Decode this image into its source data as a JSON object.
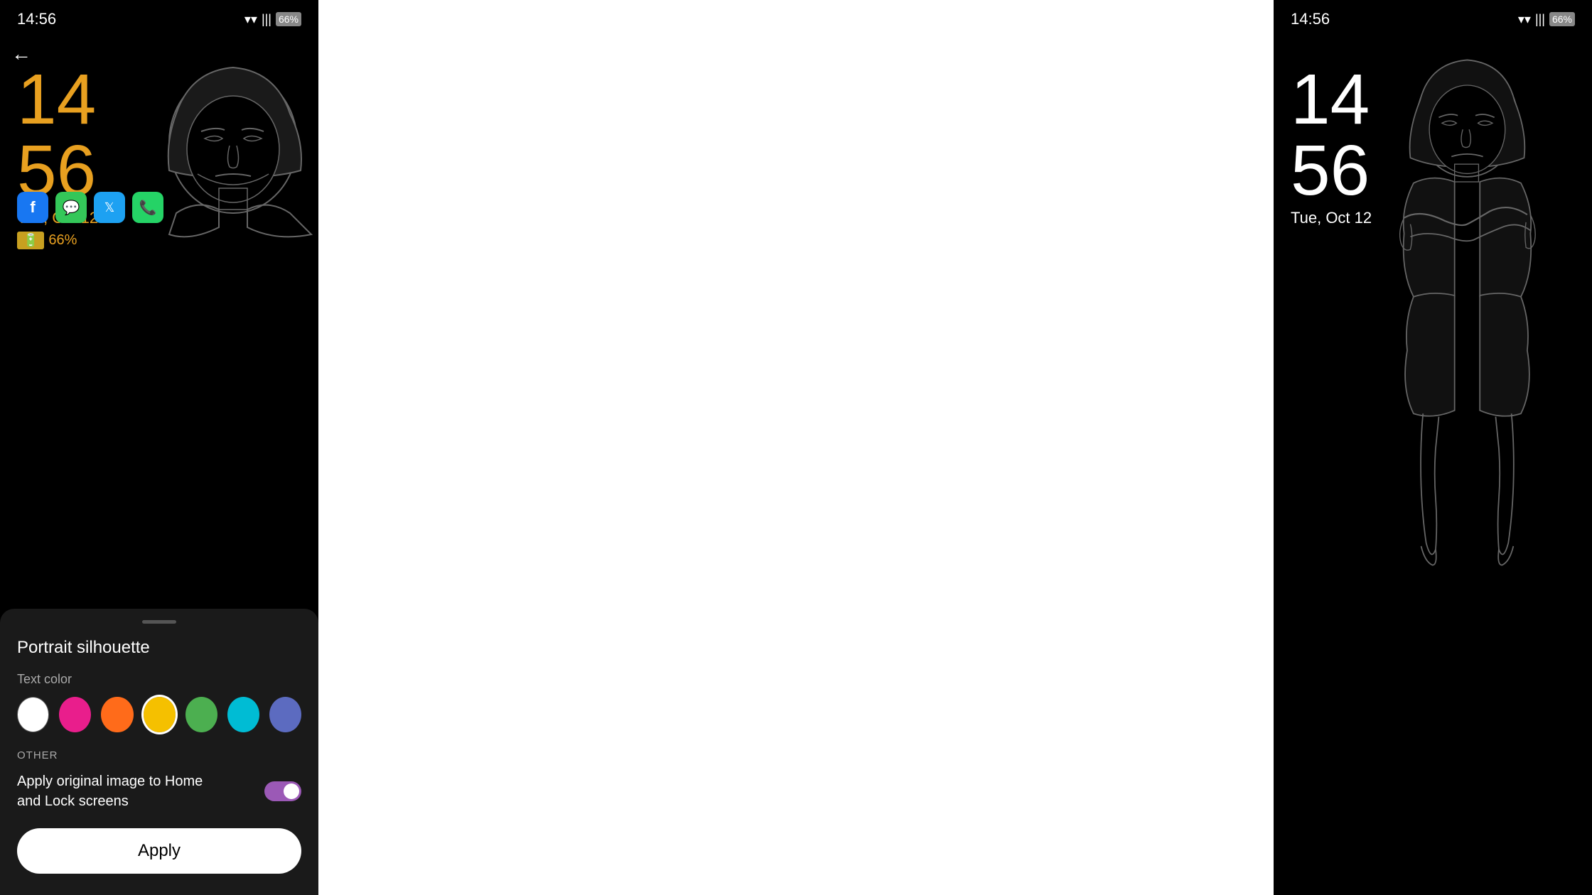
{
  "left_phone": {
    "status_bar": {
      "time": "14:56",
      "wifi_icon": "📶",
      "signal_icon": "📶",
      "battery": "66%"
    },
    "clock": {
      "hour": "14",
      "minute": "56",
      "date": "Tue, Oct 12",
      "battery_badge": "66%"
    },
    "back_button": "←",
    "bottom_sheet": {
      "title": "Portrait silhouette",
      "color_label": "Text color",
      "colors": [
        {
          "id": "white",
          "hex": "#ffffff",
          "selected": false
        },
        {
          "id": "pink",
          "hex": "#e91e8c",
          "selected": false
        },
        {
          "id": "orange",
          "hex": "#ff6b1a",
          "selected": false
        },
        {
          "id": "yellow",
          "hex": "#f5c000",
          "selected": true
        },
        {
          "id": "green",
          "hex": "#4caf50",
          "selected": false
        },
        {
          "id": "cyan",
          "hex": "#00bcd4",
          "selected": false
        },
        {
          "id": "blue",
          "hex": "#5c6bc0",
          "selected": false
        }
      ],
      "other_label": "OTHER",
      "toggle_text": "Apply original image to Home and Lock screens",
      "toggle_on": true,
      "apply_label": "Apply"
    }
  },
  "right_phone": {
    "status_bar": {
      "time": "14:56",
      "battery": "66%"
    },
    "clock": {
      "hour": "14",
      "minute": "56",
      "date": "Tue, Oct 12"
    }
  }
}
